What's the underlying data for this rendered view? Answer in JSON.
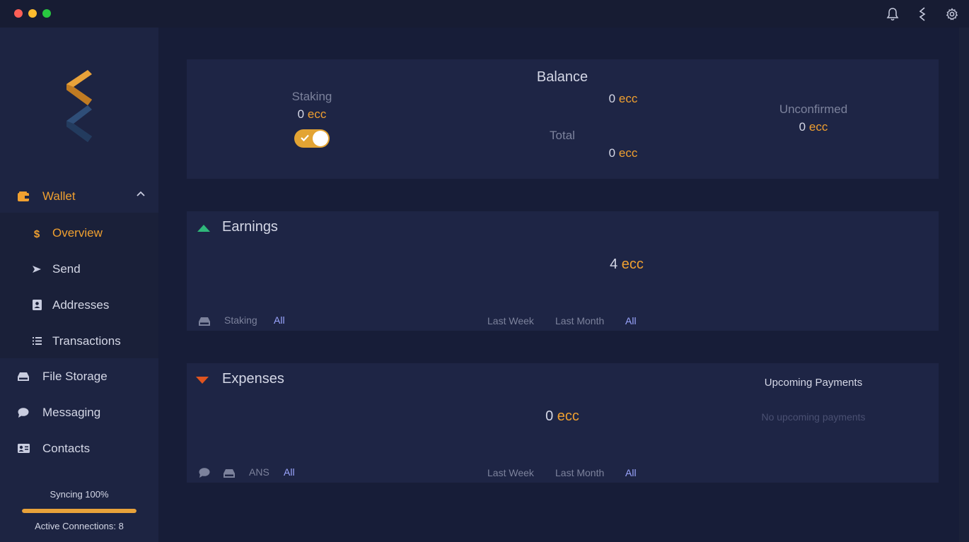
{
  "sidebar": {
    "items": [
      {
        "label": "Wallet",
        "icon": "wallet-icon"
      },
      {
        "label": "File Storage",
        "icon": "storage-icon"
      },
      {
        "label": "Messaging",
        "icon": "chat-icon"
      },
      {
        "label": "Contacts",
        "icon": "contacts-icon"
      }
    ],
    "wallet_sub": [
      {
        "label": "Overview",
        "icon": "dollar-icon"
      },
      {
        "label": "Send",
        "icon": "send-icon"
      },
      {
        "label": "Addresses",
        "icon": "address-book-icon"
      },
      {
        "label": "Transactions",
        "icon": "list-icon"
      }
    ],
    "sync_text": "Syncing 100%",
    "sync_progress": 100,
    "connections_text": "Active Connections: 8"
  },
  "balance": {
    "title": "Balance",
    "staking_label": "Staking",
    "staking_value": "0",
    "balance_value": "0",
    "total_label": "Total",
    "total_value": "0",
    "unconfirmed_label": "Unconfirmed",
    "unconfirmed_value": "0",
    "unit": "ecc",
    "staking_enabled": true
  },
  "earnings": {
    "title": "Earnings",
    "amount": "4",
    "unit": "ecc",
    "type_filters": [
      "Staking",
      "All"
    ],
    "time_filters": [
      "Last Week",
      "Last Month",
      "All"
    ]
  },
  "expenses": {
    "title": "Expenses",
    "amount": "0",
    "unit": "ecc",
    "type_filters": [
      "ANS",
      "All"
    ],
    "time_filters": [
      "Last Week",
      "Last Month",
      "All"
    ],
    "upcoming_title": "Upcoming Payments",
    "upcoming_empty": "No upcoming payments"
  },
  "colors": {
    "accent": "#f0a030",
    "link": "#9ca6ff",
    "up": "#2fb87a",
    "down": "#e0541f"
  }
}
